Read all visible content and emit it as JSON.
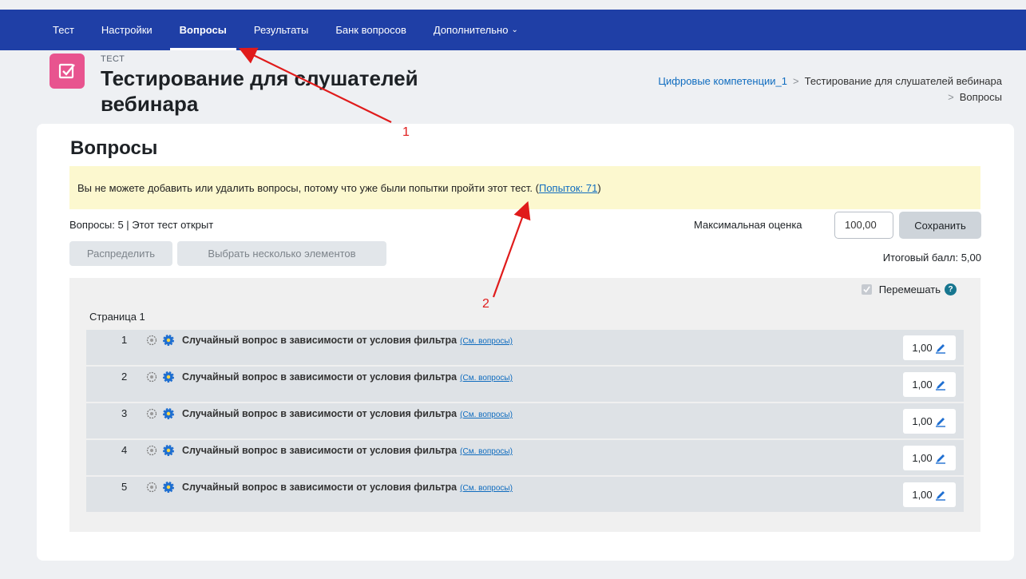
{
  "nav": {
    "tabs": [
      {
        "label": "Тест"
      },
      {
        "label": "Настройки"
      },
      {
        "label": "Вопросы"
      },
      {
        "label": "Результаты"
      },
      {
        "label": "Банк вопросов"
      },
      {
        "label": "Дополнительно"
      }
    ],
    "active": "Вопросы"
  },
  "header": {
    "kicker": "ТЕСТ",
    "title": "Тестирование для слушателей вебинара",
    "breadcrumb": [
      "Цифровые компетенции_1",
      "Тестирование для слушателей вебинара",
      "Вопросы"
    ]
  },
  "main": {
    "section_title": "Вопросы",
    "notice": "Вы не можете добавить или удалить вопросы, потому что уже были попытки пройти этот тест. (",
    "notice_link": "Попыток: 71",
    "notice_end": ")",
    "status": "Вопросы: 5 | Этот тест открыт",
    "max_grade_label": "Максимальная оценка",
    "max_grade_value": "100,00",
    "save_label": "Сохранить",
    "repaginate_label": "Распределить",
    "select_multiple_label": "Выбрать несколько элементов",
    "total_marks": "Итоговый балл: 5,00",
    "shuffle_label": "Перемешать",
    "page_label": "Страница 1",
    "questions": [
      {
        "num": "1",
        "text": "Случайный вопрос в зависимости от условия фильтра",
        "link": "(См. вопросы)",
        "mark": "1,00"
      },
      {
        "num": "2",
        "text": "Случайный вопрос в зависимости от условия фильтра",
        "link": "(См. вопросы)",
        "mark": "1,00"
      },
      {
        "num": "3",
        "text": "Случайный вопрос в зависимости от условия фильтра",
        "link": "(См. вопросы)",
        "mark": "1,00"
      },
      {
        "num": "4",
        "text": "Случайный вопрос в зависимости от условия фильтра",
        "link": "(См. вопросы)",
        "mark": "1,00"
      },
      {
        "num": "5",
        "text": "Случайный вопрос в зависимости от условия фильтра",
        "link": "(См. вопросы)",
        "mark": "1,00"
      }
    ]
  },
  "annotations": {
    "label_1": "1",
    "label_2": "2",
    "color": "#e01b1b"
  },
  "colors": {
    "nav_bg": "#1f3fa6",
    "icon_bg": "#e8548f",
    "link": "#0f6cbf",
    "notice_bg": "#fcf8cf"
  }
}
